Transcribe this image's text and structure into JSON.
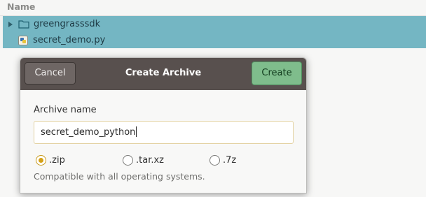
{
  "file_list": {
    "column_header": "Name",
    "rows": [
      {
        "name": "greengrasssdk",
        "icon": "folder-icon"
      },
      {
        "name": "secret_demo.py",
        "icon": "python-file-icon"
      }
    ]
  },
  "dialog": {
    "title": "Create Archive",
    "cancel_label": "Cancel",
    "create_label": "Create",
    "archive_name_label": "Archive name",
    "archive_name_value": "secret_demo_python",
    "formats": [
      {
        "label": ".zip",
        "selected": true
      },
      {
        "label": ".tar.xz",
        "selected": false
      },
      {
        "label": ".7z",
        "selected": false
      }
    ],
    "hint": "Compatible with all operating systems."
  },
  "colors": {
    "selection": "#74b6c3",
    "titlebar": "#58504e",
    "create_button": "#7fbd8c",
    "radio_accent": "#d4a017"
  }
}
